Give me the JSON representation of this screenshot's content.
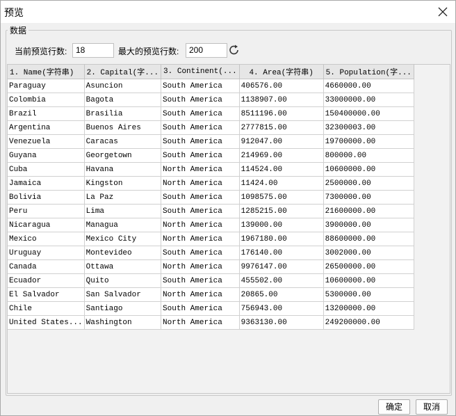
{
  "window": {
    "title": "预览"
  },
  "group": {
    "label": "数据"
  },
  "controls": {
    "current_rows_label": "当前预览行数:",
    "current_rows_value": "18",
    "max_rows_label": "最大的预览行数:",
    "max_rows_value": "200"
  },
  "table": {
    "headers": [
      "1. Name(字符串)",
      "2. Capital(字...",
      "3. Continent(...",
      "4. Area(字符串)",
      "5. Population(字..."
    ],
    "rows": [
      [
        "Paraguay",
        "Asuncion",
        "South America",
        "406576.00",
        "4660000.00"
      ],
      [
        "Colombia",
        "Bagota",
        "South America",
        "1138907.00",
        "33000000.00"
      ],
      [
        "Brazil",
        "Brasilia",
        "South America",
        "8511196.00",
        "150400000.00"
      ],
      [
        "Argentina",
        "Buenos Aires",
        "South America",
        "2777815.00",
        "32300003.00"
      ],
      [
        "Venezuela",
        "Caracas",
        "South America",
        "912047.00",
        "19700000.00"
      ],
      [
        "Guyana",
        "Georgetown",
        "South America",
        "214969.00",
        "800000.00"
      ],
      [
        "Cuba",
        "Havana",
        "North America",
        "114524.00",
        "10600000.00"
      ],
      [
        "Jamaica",
        "Kingston",
        "North America",
        "11424.00",
        "2500000.00"
      ],
      [
        "Bolivia",
        "La Paz",
        "South America",
        "1098575.00",
        "7300000.00"
      ],
      [
        "Peru",
        "Lima",
        "South America",
        "1285215.00",
        "21600000.00"
      ],
      [
        "Nicaragua",
        "Managua",
        "North America",
        "139000.00",
        "3900000.00"
      ],
      [
        "Mexico",
        "Mexico City",
        "North America",
        "1967180.00",
        "88600000.00"
      ],
      [
        "Uruguay",
        "Montevideo",
        "South America",
        "176140.00",
        "3002000.00"
      ],
      [
        "Canada",
        "Ottawa",
        "North America",
        "9976147.00",
        "26500000.00"
      ],
      [
        "Ecuador",
        "Quito",
        "South America",
        "455502.00",
        "10600000.00"
      ],
      [
        "El Salvador",
        "San Salvador",
        "North America",
        "20865.00",
        "5300000.00"
      ],
      [
        "Chile",
        "Santiago",
        "South America",
        "756943.00",
        "13200000.00"
      ],
      [
        "United States...",
        "Washington",
        "North America",
        "9363130.00",
        "249200000.00"
      ]
    ]
  },
  "buttons": {
    "ok": "确定",
    "cancel": "取消"
  },
  "icons": {
    "close": "close-icon",
    "refresh": "refresh-icon"
  }
}
